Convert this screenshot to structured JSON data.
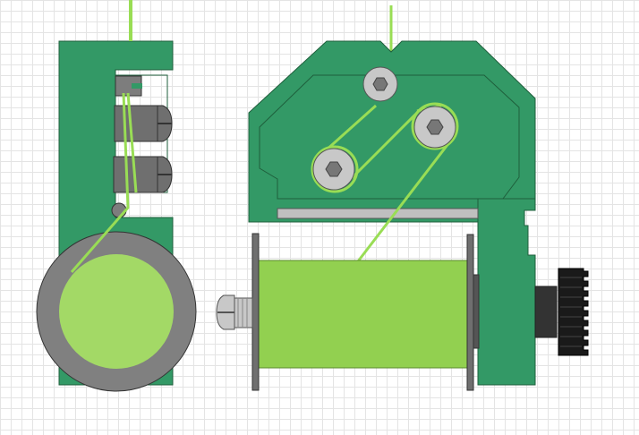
{
  "diagram": {
    "subject": "filament-spool-feeder-mechanism",
    "views": [
      "side-view",
      "front-view"
    ],
    "colors": {
      "grid": "#e4e4e4",
      "housing": "#339966",
      "housing_outline": "#1f5f3c",
      "filament": "#99dd55",
      "spool": "#92d050",
      "spool_side": "#a3d966",
      "hardware": "#c8c8c8",
      "hardware_dark": "#555555",
      "ring": "#808080",
      "gear": "#1a1a1a"
    }
  }
}
